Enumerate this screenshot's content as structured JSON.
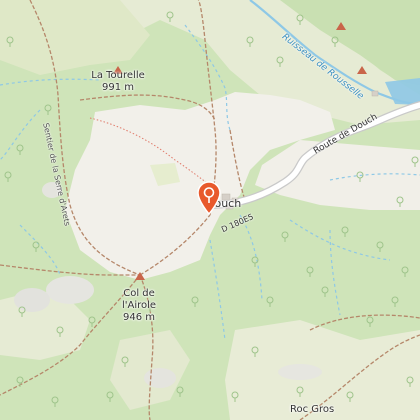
{
  "labels": {
    "la_tourelle": "La Tourelle",
    "la_tourelle_alt": "991 m",
    "col_airole": "Col de",
    "col_airole_2": "l'Airole",
    "col_airole_alt": "946 m",
    "douch": "Douch",
    "route_de_douch": "Route de Douch",
    "d180e5": "D 180E5",
    "ruisseau": "Ruisseau de Rousselle",
    "sentier": "Sentier de la Serre d'Arets",
    "roc_gros": "Roc Gros"
  },
  "colors": {
    "forest": "#cde3b6",
    "meadow": "#e9ecd6",
    "clearing": "#f2f0ea",
    "road": "#ffffff",
    "road_casing": "#c9c9c9",
    "stream": "#8ec8e6",
    "trail": "#b5876a",
    "marker": "#e8592c"
  },
  "icons": {
    "marker": "location-pin-icon",
    "peak": "peak-triangle-icon",
    "tree": "tree-icon"
  }
}
